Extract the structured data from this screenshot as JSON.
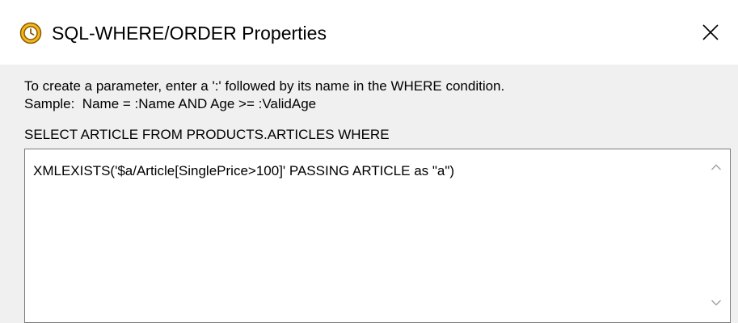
{
  "window": {
    "title": "SQL-WHERE/ORDER Properties"
  },
  "instructions": {
    "line1": "To create a parameter, enter a ':' followed by its name in the WHERE condition.",
    "line2": "Sample:  Name = :Name AND Age >= :ValidAge"
  },
  "query": {
    "label": "SELECT ARTICLE FROM PRODUCTS.ARTICLES WHERE",
    "condition": "XMLEXISTS('$a/Article[SinglePrice>100]' PASSING ARTICLE as \"a\")"
  },
  "icons": {
    "app": "alarm-clock-icon",
    "close": "close-icon",
    "scroll_up": "chevron-up-icon",
    "scroll_down": "chevron-down-icon"
  },
  "colors": {
    "app_icon_fill": "#f5b81c",
    "app_icon_stroke": "#8a5a00",
    "window_bg": "#f0f0f0",
    "titlebar_bg": "#ffffff",
    "editor_border": "#7a7a7a",
    "scroll_arrow": "#a0a0a0"
  }
}
